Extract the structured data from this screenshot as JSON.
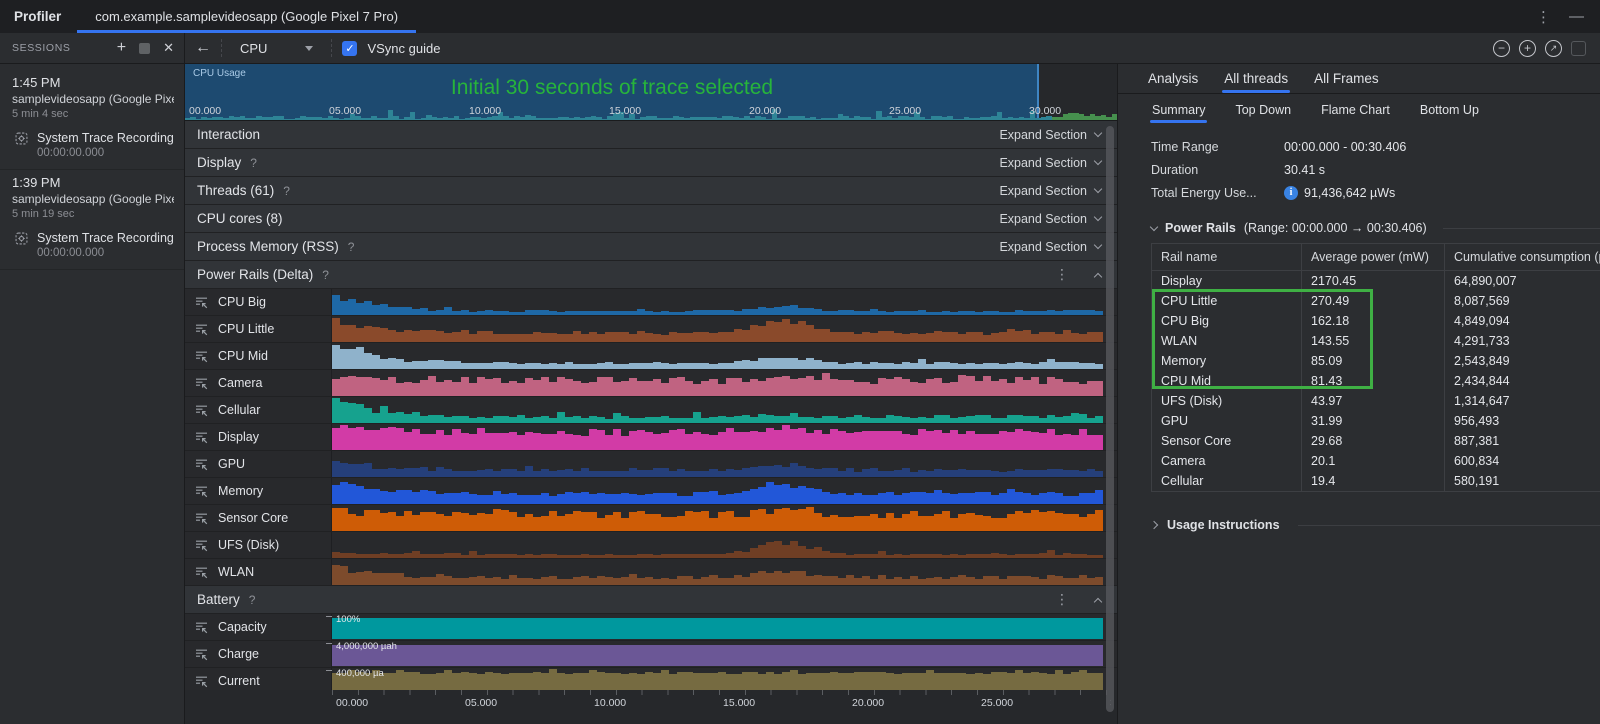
{
  "window": {
    "app_title": "Profiler",
    "tab_label": "com.example.samplevideosapp (Google Pixel 7 Pro)"
  },
  "toolbar": {
    "sessions_label": "SESSIONS",
    "view_selector_value": "CPU",
    "vsync_label": "VSync guide"
  },
  "sessions": [
    {
      "time": "1:45 PM",
      "name": "samplevideosapp (Google Pixel ...",
      "duration": "5 min 4 sec",
      "recording": {
        "label": "System Trace Recording",
        "timestamp": "00:00:00.000"
      }
    },
    {
      "time": "1:39 PM",
      "name": "samplevideosapp (Google Pixel ...",
      "duration": "5 min 19 sec",
      "recording": {
        "label": "System Trace Recording",
        "timestamp": "00:00:00.000"
      }
    }
  ],
  "timeline": {
    "track_label": "CPU Usage",
    "annotation": "Initial 30 seconds of trace selected",
    "axis_ticks": [
      "00.000",
      "05.000",
      "10.000",
      "15.000",
      "20.000",
      "25.000",
      "30.000"
    ]
  },
  "labels": {
    "expand_section": "Expand Section"
  },
  "sections": [
    {
      "label": "Interaction",
      "help": false
    },
    {
      "label": "Display",
      "help": true
    },
    {
      "label": "Threads (61)",
      "help": true
    },
    {
      "label": "CPU cores (8)",
      "help": false
    },
    {
      "label": "Process Memory (RSS)",
      "help": true
    }
  ],
  "power_rails_section": {
    "label": "Power Rails (Delta)",
    "help": true
  },
  "rails": [
    {
      "label": "CPU Big",
      "color": "#1e68a6"
    },
    {
      "label": "CPU Little",
      "color": "#8a4a2b"
    },
    {
      "label": "CPU Mid",
      "color": "#8fb2cb"
    },
    {
      "label": "Camera",
      "color": "#c06381"
    },
    {
      "label": "Cellular",
      "color": "#16a28e"
    },
    {
      "label": "Display",
      "color": "#d23ba6"
    },
    {
      "label": "GPU",
      "color": "#253f7a"
    },
    {
      "label": "Memory",
      "color": "#2257d8"
    },
    {
      "label": "Sensor Core",
      "color": "#ce5c06"
    },
    {
      "label": "UFS (Disk)",
      "color": "#6f3e24"
    },
    {
      "label": "WLAN",
      "color": "#7d4b2c"
    }
  ],
  "battery_section": {
    "label": "Battery",
    "help": true
  },
  "battery_rows": [
    {
      "label": "Capacity",
      "value_label": "100%",
      "color": "#00989e",
      "style": "flat"
    },
    {
      "label": "Charge",
      "value_label": "4,000,000 µah",
      "color": "#6b5796",
      "style": "flat"
    },
    {
      "label": "Current",
      "value_label": "400,000 µa",
      "color": "#766b41",
      "style": "wavy"
    }
  ],
  "bottom_axis_ticks": [
    "00.000",
    "05.000",
    "10.000",
    "15.000",
    "20.000",
    "25.000",
    "30.000"
  ],
  "right_panel": {
    "tabs": [
      "Analysis",
      "All threads",
      "All Frames"
    ],
    "active_tab": "All threads",
    "subtabs": [
      "Summary",
      "Top Down",
      "Flame Chart",
      "Bottom Up"
    ],
    "active_subtab": "Summary",
    "summary": {
      "time_range_label": "Time Range",
      "time_range_value": "00:00.000 - 00:30.406",
      "duration_label": "Duration",
      "duration_value": "30.41 s",
      "energy_label": "Total Energy Use...",
      "energy_value": "91,436,642 µWs"
    },
    "power_rails_table": {
      "title": "Power Rails",
      "range": "(Range: 00:00.000 → 00:30.406)",
      "columns": [
        "Rail name",
        "Average power (mW)",
        "Cumulative consumption (µWs)"
      ],
      "rows": [
        [
          "Display",
          "2170.45",
          "64,890,007"
        ],
        [
          "CPU Little",
          "270.49",
          "8,087,569"
        ],
        [
          "CPU Big",
          "162.18",
          "4,849,094"
        ],
        [
          "WLAN",
          "143.55",
          "4,291,733"
        ],
        [
          "Memory",
          "85.09",
          "2,543,849"
        ],
        [
          "CPU Mid",
          "81.43",
          "2,434,844"
        ],
        [
          "UFS (Disk)",
          "43.97",
          "1,314,647"
        ],
        [
          "GPU",
          "31.99",
          "956,493"
        ],
        [
          "Sensor Core",
          "29.68",
          "887,381"
        ],
        [
          "Camera",
          "20.1",
          "600,834"
        ],
        [
          "Cellular",
          "19.4",
          "580,191"
        ]
      ],
      "highlight": {
        "first_row": "CPU Little",
        "last_row": "CPU Mid",
        "color": "#3fb044"
      }
    },
    "usage_instructions_label": "Usage Instructions"
  },
  "colors": {
    "accent_blue": "#3574f0",
    "annotation_green": "#27b43b",
    "highlight_green": "#3fb044",
    "selection_blue": "#1d4a70",
    "spark_teal": "#2e8496",
    "spark_green": "#46904e"
  }
}
